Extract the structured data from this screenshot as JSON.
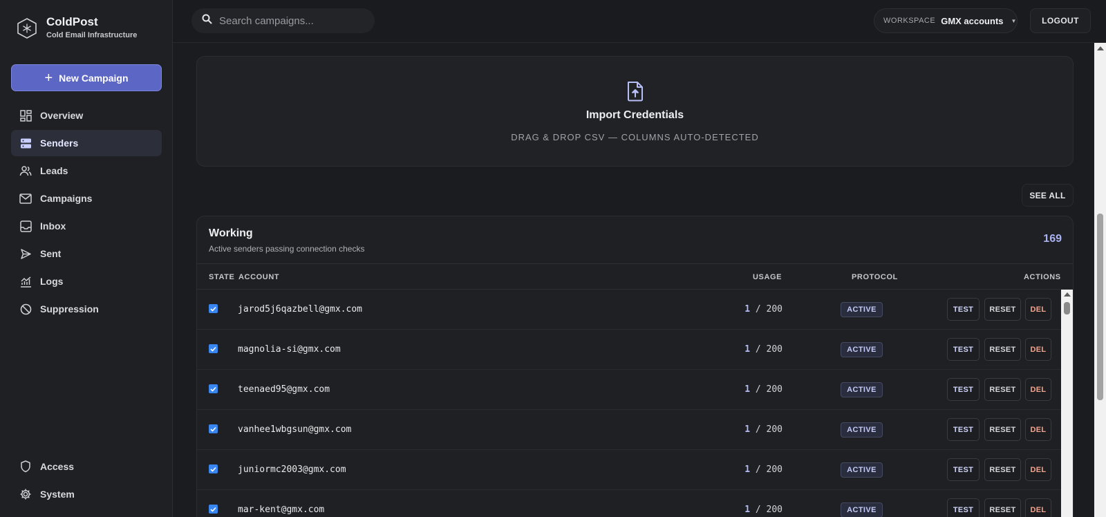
{
  "brand": {
    "title": "ColdPost",
    "subtitle": "Cold Email Infrastructure"
  },
  "sidebar": {
    "new_campaign_label": "New Campaign",
    "items": [
      {
        "label": "Overview",
        "icon": "grid-icon"
      },
      {
        "label": "Senders",
        "icon": "server-icon",
        "active": true
      },
      {
        "label": "Leads",
        "icon": "users-icon"
      },
      {
        "label": "Campaigns",
        "icon": "mail-icon"
      },
      {
        "label": "Inbox",
        "icon": "inbox-icon"
      },
      {
        "label": "Sent",
        "icon": "send-icon"
      },
      {
        "label": "Logs",
        "icon": "chart-icon"
      },
      {
        "label": "Suppression",
        "icon": "ban-icon"
      }
    ],
    "bottom_items": [
      {
        "label": "Access",
        "icon": "shield-icon"
      },
      {
        "label": "System",
        "icon": "gear-icon"
      }
    ]
  },
  "topbar": {
    "search_placeholder": "Search campaigns...",
    "workspace_label": "WORKSPACE",
    "workspace_value": "GMX accounts",
    "logout_label": "LOGOUT"
  },
  "import": {
    "title": "Import Credentials",
    "subtitle": "DRAG & DROP CSV — COLUMNS AUTO-DETECTED"
  },
  "see_all_label": "SEE ALL",
  "working": {
    "title": "Working",
    "subtitle": "Active senders passing connection checks",
    "count": "169",
    "columns": {
      "state": "STATE",
      "account": "ACCOUNT",
      "usage": "USAGE",
      "protocol": "PROTOCOL",
      "actions": "ACTIONS"
    },
    "rows": [
      {
        "email": "jarod5j6qazbell@gmx.com",
        "used": "1",
        "limit": "/ 200",
        "protocol": "ACTIVE",
        "test": "TEST",
        "reset": "RESET",
        "del": "DEL"
      },
      {
        "email": "magnolia-si@gmx.com",
        "used": "1",
        "limit": "/ 200",
        "protocol": "ACTIVE",
        "test": "TEST",
        "reset": "RESET",
        "del": "DEL"
      },
      {
        "email": "teenaed95@gmx.com",
        "used": "1",
        "limit": "/ 200",
        "protocol": "ACTIVE",
        "test": "TEST",
        "reset": "RESET",
        "del": "DEL"
      },
      {
        "email": "vanhee1wbgsun@gmx.com",
        "used": "1",
        "limit": "/ 200",
        "protocol": "ACTIVE",
        "test": "TEST",
        "reset": "RESET",
        "del": "DEL"
      },
      {
        "email": "juniormc2003@gmx.com",
        "used": "1",
        "limit": "/ 200",
        "protocol": "ACTIVE",
        "test": "TEST",
        "reset": "RESET",
        "del": "DEL"
      },
      {
        "email": "mar-kent@gmx.com",
        "used": "1",
        "limit": "/ 200",
        "protocol": "ACTIVE",
        "test": "TEST",
        "reset": "RESET",
        "del": "DEL"
      }
    ]
  },
  "colors": {
    "accent": "#5c66c4",
    "checkbox": "#3a86f0",
    "delete": "#f3a48e",
    "count": "#aab2f2"
  }
}
